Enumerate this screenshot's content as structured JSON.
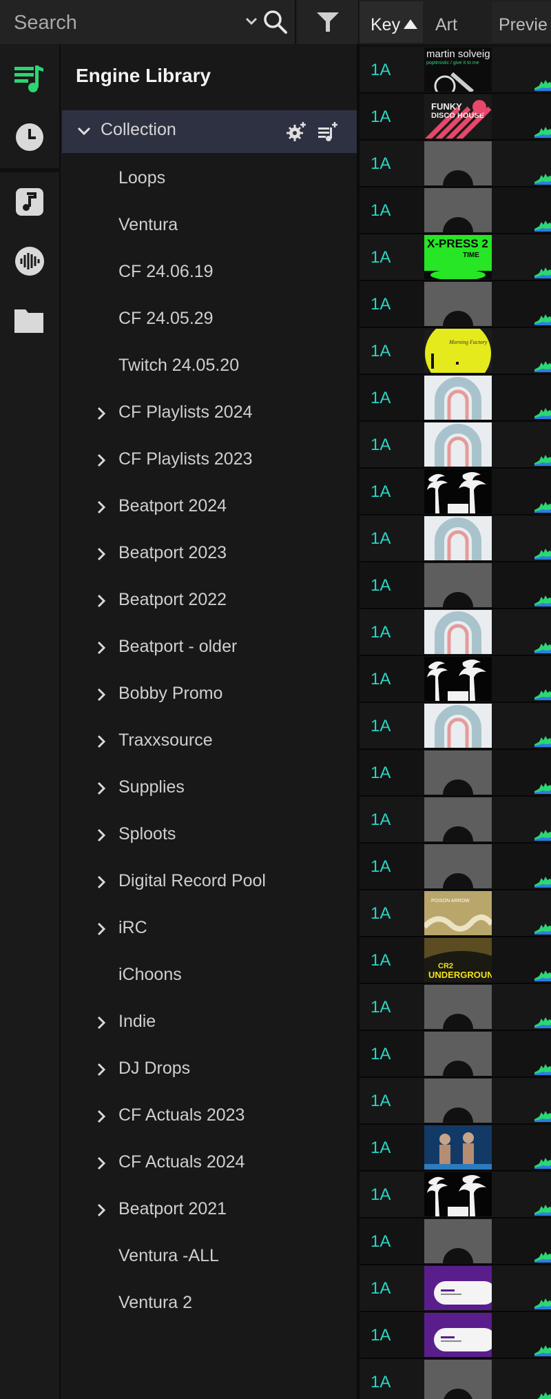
{
  "search": {
    "placeholder": "Search"
  },
  "sidebar_icons": [
    {
      "name": "playlist-icon"
    },
    {
      "name": "history-icon"
    },
    {
      "name": "music-note-icon"
    },
    {
      "name": "soundcloud-icon"
    },
    {
      "name": "folder-icon"
    }
  ],
  "library": {
    "title": "Engine Library",
    "collection_label": "Collection",
    "items": [
      {
        "label": "Loops",
        "expandable": false
      },
      {
        "label": "Ventura",
        "expandable": false
      },
      {
        "label": "CF 24.06.19",
        "expandable": false
      },
      {
        "label": "CF 24.05.29",
        "expandable": false
      },
      {
        "label": "Twitch 24.05.20",
        "expandable": false
      },
      {
        "label": "CF Playlists 2024",
        "expandable": true
      },
      {
        "label": "CF Playlists 2023",
        "expandable": true
      },
      {
        "label": "Beatport 2024",
        "expandable": true
      },
      {
        "label": "Beatport 2023",
        "expandable": true
      },
      {
        "label": "Beatport 2022",
        "expandable": true
      },
      {
        "label": "Beatport - older",
        "expandable": true
      },
      {
        "label": "Bobby Promo",
        "expandable": true
      },
      {
        "label": "Traxxsource",
        "expandable": true
      },
      {
        "label": "Supplies",
        "expandable": true
      },
      {
        "label": "Sploots",
        "expandable": true
      },
      {
        "label": "Digital Record Pool",
        "expandable": true
      },
      {
        "label": "iRC",
        "expandable": true
      },
      {
        "label": "iChoons",
        "expandable": false
      },
      {
        "label": "Indie",
        "expandable": true
      },
      {
        "label": "DJ Drops",
        "expandable": true
      },
      {
        "label": "CF Actuals 2023",
        "expandable": true
      },
      {
        "label": "CF Actuals 2024",
        "expandable": true
      },
      {
        "label": "Beatport 2021",
        "expandable": true
      },
      {
        "label": "Ventura -ALL",
        "expandable": false
      },
      {
        "label": "Ventura 2",
        "expandable": false
      }
    ]
  },
  "tracks": {
    "headers": {
      "key": "Key",
      "art": "Art",
      "preview": "Previe"
    },
    "rows": [
      {
        "key": "1A",
        "art": "solveig",
        "art_text": "martin solveig",
        "art_sub": "poptimistic / give it to me"
      },
      {
        "key": "1A",
        "art": "funky",
        "art_text": "FUNKY DISCO HOUSE"
      },
      {
        "key": "1A",
        "art": "blank"
      },
      {
        "key": "1A",
        "art": "blank"
      },
      {
        "key": "1A",
        "art": "xpress",
        "art_text": "X-PRESS 2",
        "art_sub": "TIME"
      },
      {
        "key": "1A",
        "art": "blank"
      },
      {
        "key": "1A",
        "art": "morning",
        "art_text": "Morning Factory"
      },
      {
        "key": "1A",
        "art": "arch"
      },
      {
        "key": "1A",
        "art": "arch"
      },
      {
        "key": "1A",
        "art": "palm"
      },
      {
        "key": "1A",
        "art": "arch"
      },
      {
        "key": "1A",
        "art": "blank"
      },
      {
        "key": "1A",
        "art": "arch"
      },
      {
        "key": "1A",
        "art": "palm"
      },
      {
        "key": "1A",
        "art": "arch"
      },
      {
        "key": "1A",
        "art": "blank"
      },
      {
        "key": "1A",
        "art": "blank"
      },
      {
        "key": "1A",
        "art": "blank"
      },
      {
        "key": "1A",
        "art": "poison",
        "art_text": "POISON ARROW"
      },
      {
        "key": "1A",
        "art": "underground",
        "art_text": "UNDERGROUND",
        "art_sub": "CR2"
      },
      {
        "key": "1A",
        "art": "blank"
      },
      {
        "key": "1A",
        "art": "blank"
      },
      {
        "key": "1A",
        "art": "blank"
      },
      {
        "key": "1A",
        "art": "photo"
      },
      {
        "key": "1A",
        "art": "palm"
      },
      {
        "key": "1A",
        "art": "blank"
      },
      {
        "key": "1A",
        "art": "purple"
      },
      {
        "key": "1A",
        "art": "purple"
      },
      {
        "key": "1A",
        "art": "blank"
      }
    ]
  },
  "colors": {
    "accent_green": "#2bd673",
    "key_teal": "#29d6c6",
    "selected_row": "#2d3142"
  }
}
